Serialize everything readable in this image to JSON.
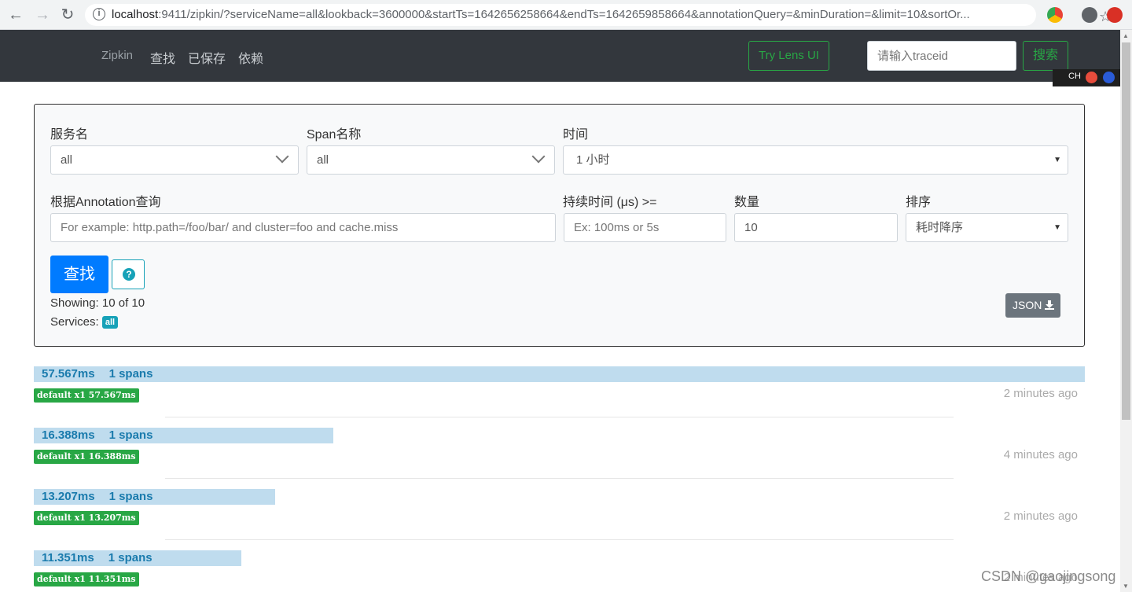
{
  "browser": {
    "url_host": "localhost",
    "url_rest": ":9411/zipkin/?serviceName=all&lookback=3600000&startTs=1642656258664&endTs=1642659858664&annotationQuery=&minDuration=&limit=10&sortOr..."
  },
  "navbar": {
    "brand": "Zipkin",
    "links": [
      "查找",
      "已保存",
      "依赖"
    ],
    "lens_button": "Try Lens UI",
    "traceid_placeholder": "请输入traceid",
    "search_button": "搜索"
  },
  "ime": {
    "label": "CH"
  },
  "search": {
    "service_label": "服务名",
    "service_value": "all",
    "span_label": "Span名称",
    "span_value": "all",
    "time_label": "时间",
    "time_value": "1 小时",
    "annotation_label": "根据Annotation查询",
    "annotation_placeholder": "For example: http.path=/foo/bar/ and cluster=foo and cache.miss",
    "duration_label": "持续时间 (μs) >=",
    "duration_placeholder": "Ex: 100ms or 5s",
    "limit_label": "数量",
    "limit_value": "10",
    "sort_label": "排序",
    "sort_value": "耗时降序",
    "find_button": "查找",
    "help_icon": "?",
    "showing": "Showing: 10 of 10",
    "services_label": "Services:",
    "services_badge": "all",
    "json_button": "JSON"
  },
  "results": [
    {
      "duration": "57.567ms",
      "spans": "1 spans",
      "tag": "default x1 57.567ms",
      "ago": "2 minutes ago",
      "width_fraction": 1.0
    },
    {
      "duration": "16.388ms",
      "spans": "1 spans",
      "tag": "default x1 16.388ms",
      "ago": "4 minutes ago",
      "width_fraction": 0.2847
    },
    {
      "duration": "13.207ms",
      "spans": "1 spans",
      "tag": "default x1 13.207ms",
      "ago": "2 minutes ago",
      "width_fraction": 0.2294
    },
    {
      "duration": "11.351ms",
      "spans": "1 spans",
      "tag": "default x1 11.351ms",
      "ago": "2 minutes ago",
      "width_fraction": 0.1972
    }
  ],
  "watermark": "CSDN @gaojingsong",
  "colors": {
    "navbar": "#33373d",
    "primary": "#007bff",
    "success": "#28a745",
    "info": "#17a2b8",
    "bar": "#bfdcee",
    "bar_text": "#1a7bad"
  }
}
